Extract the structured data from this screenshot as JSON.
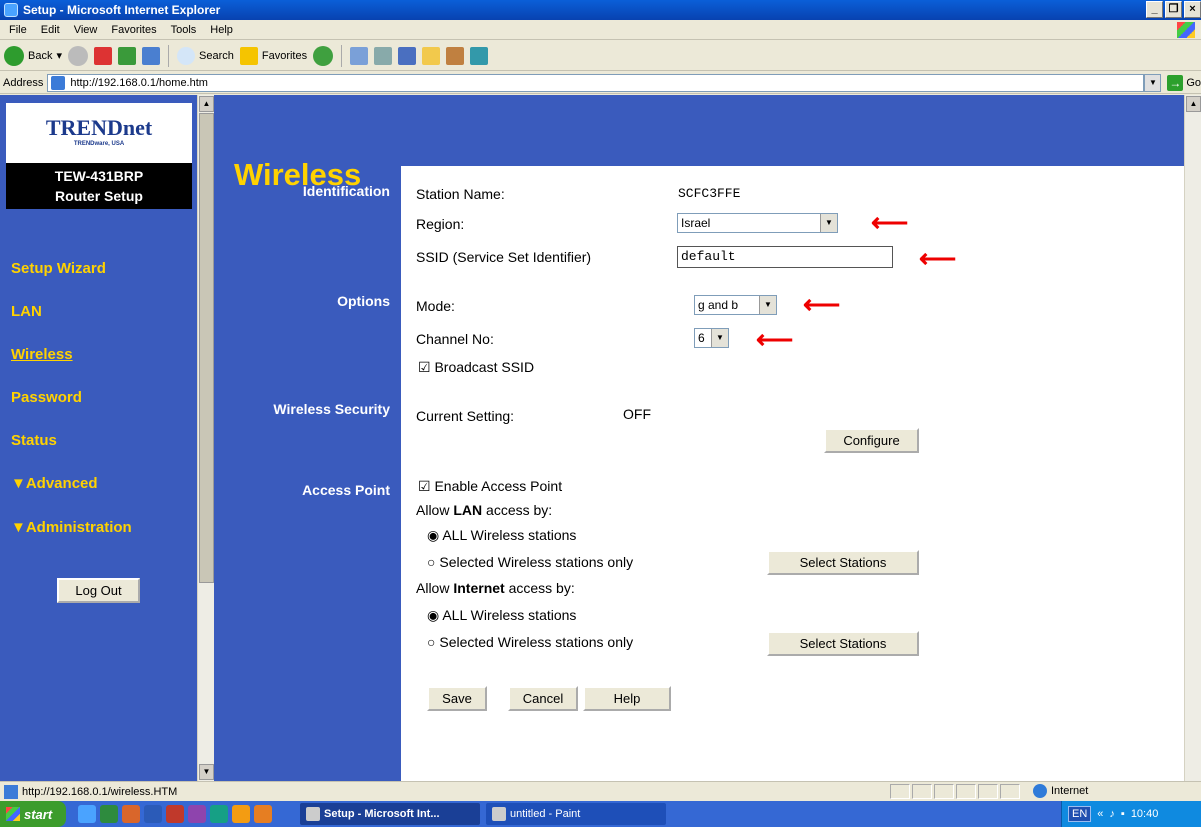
{
  "window": {
    "title": "Setup - Microsoft Internet Explorer",
    "buttons": [
      "_",
      "❐",
      "×"
    ]
  },
  "menu": [
    "File",
    "Edit",
    "View",
    "Favorites",
    "Tools",
    "Help"
  ],
  "toolbar": {
    "back": "Back",
    "search": "Search",
    "favorites": "Favorites"
  },
  "address": {
    "label": "Address",
    "url": "http://192.168.0.1/home.htm",
    "go": "Go"
  },
  "sidebar": {
    "brand": "TRENDnet",
    "brand_sub": "TRENDware, USA",
    "model": "TEW-431BRP",
    "model_sub": "Router Setup",
    "items": [
      {
        "label": "Setup Wizard"
      },
      {
        "label": "LAN"
      },
      {
        "label": "Wireless"
      },
      {
        "label": "Password"
      },
      {
        "label": "Status"
      },
      {
        "label": "▼Advanced"
      },
      {
        "label": "▼Administration"
      }
    ],
    "logout": "Log Out"
  },
  "page": {
    "title": "Wireless",
    "sections": {
      "identification": "Identification",
      "options": "Options",
      "security": "Wireless Security",
      "access_point": "Access Point"
    },
    "identification": {
      "station_label": "Station Name:",
      "station_value": "SCFC3FFE",
      "region_label": "Region:",
      "region_value": "Israel",
      "ssid_label": "SSID (Service Set Identifier)",
      "ssid_value": "default"
    },
    "options": {
      "mode_label": "Mode:",
      "mode_value": "g and b",
      "channel_label": "Channel No:",
      "channel_value": "6",
      "broadcast_label": "Broadcast SSID"
    },
    "security": {
      "current_label": "Current Setting:",
      "current_value": "OFF",
      "configure": "Configure"
    },
    "access_point": {
      "enable_label": "Enable Access Point",
      "lan_prefix": "Allow ",
      "lan_bold": "LAN",
      "lan_suffix": " access by:",
      "all_stations": "ALL Wireless stations",
      "selected_stations": "Selected Wireless stations only",
      "select_button": "Select Stations",
      "inet_prefix": "Allow ",
      "inet_bold": "Internet",
      "inet_suffix": " access by:"
    },
    "buttons": {
      "save": "Save",
      "cancel": "Cancel",
      "help": "Help"
    }
  },
  "status": {
    "url": "http://192.168.0.1/wireless.HTM",
    "zone": "Internet"
  },
  "taskbar": {
    "start": "start",
    "tasks": [
      {
        "label": "Setup - Microsoft Int..."
      },
      {
        "label": "untitled - Paint"
      }
    ],
    "lang": "EN",
    "time": "10:40"
  },
  "colors": {
    "nav_bg": "#3a5bbd",
    "nav_text": "#ffd200",
    "arrow": "#e00000"
  }
}
